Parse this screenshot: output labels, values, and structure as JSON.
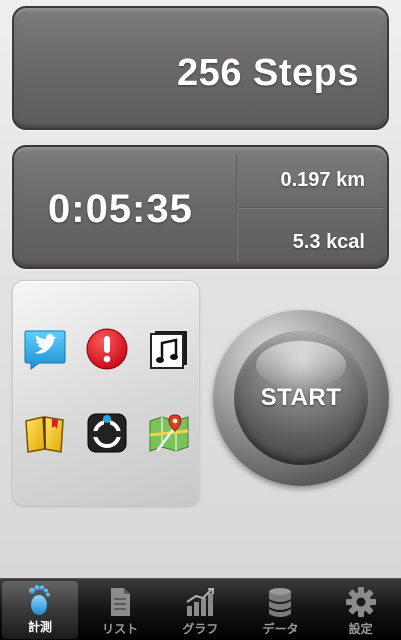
{
  "steps": {
    "text": "256 Steps"
  },
  "stats": {
    "time": "0:05:35",
    "distance": "0.197 km",
    "calories": "5.3 kcal"
  },
  "apps": [
    {
      "icon": "twitter-icon"
    },
    {
      "icon": "alert-icon"
    },
    {
      "icon": "music-icon"
    },
    {
      "icon": "notebook-icon"
    },
    {
      "icon": "compass-icon"
    },
    {
      "icon": "map-icon"
    }
  ],
  "start": {
    "label": "START"
  },
  "tabs": [
    {
      "label": "計測",
      "icon": "footprint-icon",
      "active": true
    },
    {
      "label": "リスト",
      "icon": "document-icon",
      "active": false
    },
    {
      "label": "グラフ",
      "icon": "graph-icon",
      "active": false
    },
    {
      "label": "データ",
      "icon": "database-icon",
      "active": false
    },
    {
      "label": "設定",
      "icon": "gear-icon",
      "active": false
    }
  ],
  "colors": {
    "panel": "#6a6868",
    "tab_bar": "#141414",
    "twitter": "#2aa9e0",
    "alert": "#e0101a"
  }
}
